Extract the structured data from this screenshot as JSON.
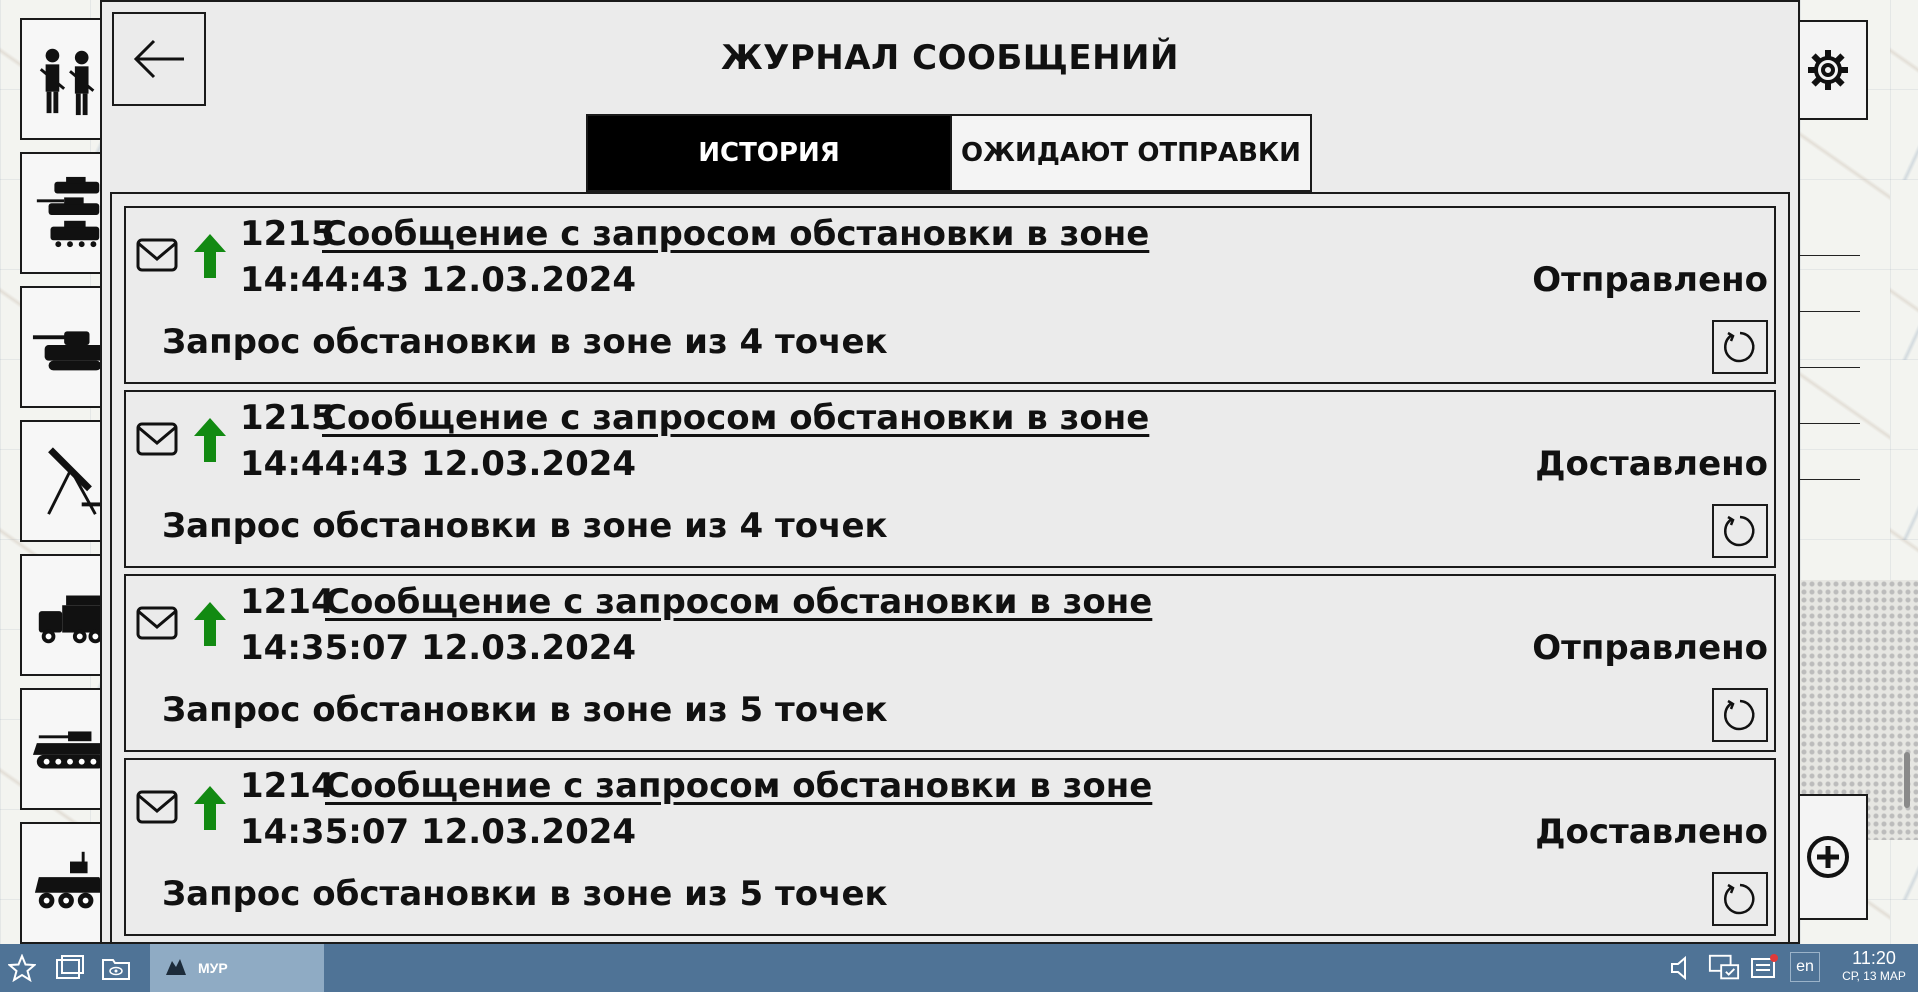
{
  "dialog": {
    "title": "ЖУРНАЛ СООБЩЕНИЙ",
    "tabs": [
      {
        "label": "ИСТОРИЯ",
        "active": true
      },
      {
        "label": "ОЖИДАЮТ ОТПРАВКИ",
        "active": false
      }
    ]
  },
  "messages": [
    {
      "number": "1215",
      "subject": "Сообщение с запросом обстановки в зоне",
      "time": "14:44:43 12.03.2024",
      "status": "Отправлено",
      "description": "Запрос обстановки в зоне из 4 точек",
      "direction_icon": "arrow-up-icon"
    },
    {
      "number": "1215",
      "subject": "Сообщение с запросом обстановки в зоне",
      "time": "14:44:43 12.03.2024",
      "status": "Доставлено",
      "description": "Запрос обстановки в зоне из 4 точек",
      "direction_icon": "arrow-up-icon"
    },
    {
      "number": "1214",
      "subject": "Сообщение с запросом обстановки в зоне",
      "time": "14:35:07 12.03.2024",
      "status": "Отправлено",
      "description": "Запрос обстановки в зоне из 5 точек",
      "direction_icon": "arrow-up-icon"
    },
    {
      "number": "1214",
      "subject": "Сообщение с запросом обстановки в зоне",
      "time": "14:35:07 12.03.2024",
      "status": "Доставлено",
      "description": "Запрос обстановки в зоне из 5 точек",
      "direction_icon": "arrow-up-icon"
    }
  ],
  "left_toolbar": {
    "items": [
      "soldiers-icon",
      "armored-column-icon",
      "tank-icon",
      "mortar-icon",
      "truck-icon",
      "ifv-icon",
      "apc-icon"
    ]
  },
  "right_toolbar": {
    "items": [
      "gear-icon",
      "zoom-in-icon"
    ]
  },
  "taskbar": {
    "app_label": "МУР",
    "language": "en",
    "time": "11:20",
    "date": "СР, 13 МАР"
  },
  "colors": {
    "accent_arrow": "#128a12",
    "taskbar": "#4f7396",
    "active_tab": "#000000"
  }
}
